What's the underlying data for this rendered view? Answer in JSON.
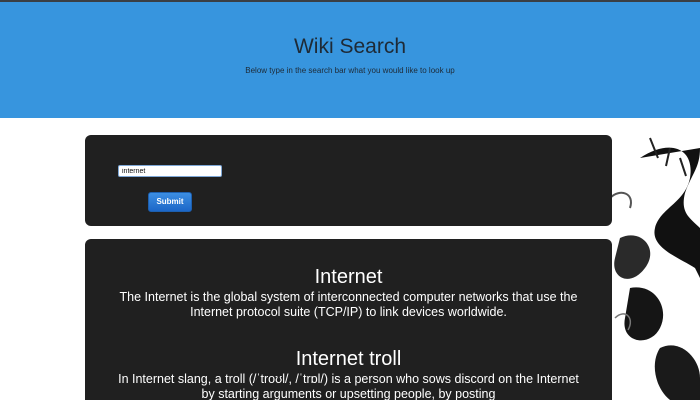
{
  "header": {
    "title": "Wiki Search",
    "subtitle": "Below type in the search bar what you would like to look up"
  },
  "search": {
    "value": "internet",
    "submit_label": "Submit"
  },
  "results": [
    {
      "title": "Internet",
      "description": "The Internet is the global system of interconnected computer networks that use the Internet protocol suite (TCP/IP) to link devices worldwide."
    },
    {
      "title": "Internet troll",
      "description": "In Internet slang, a troll (/ˈtroʊl/, /ˈtrɒl/) is a person who sows discord on the Internet by starting arguments or upsetting people, by posting"
    }
  ],
  "colors": {
    "header_bg": "#3795de",
    "card_bg": "#202020",
    "button_bg": "#1c67c8"
  }
}
